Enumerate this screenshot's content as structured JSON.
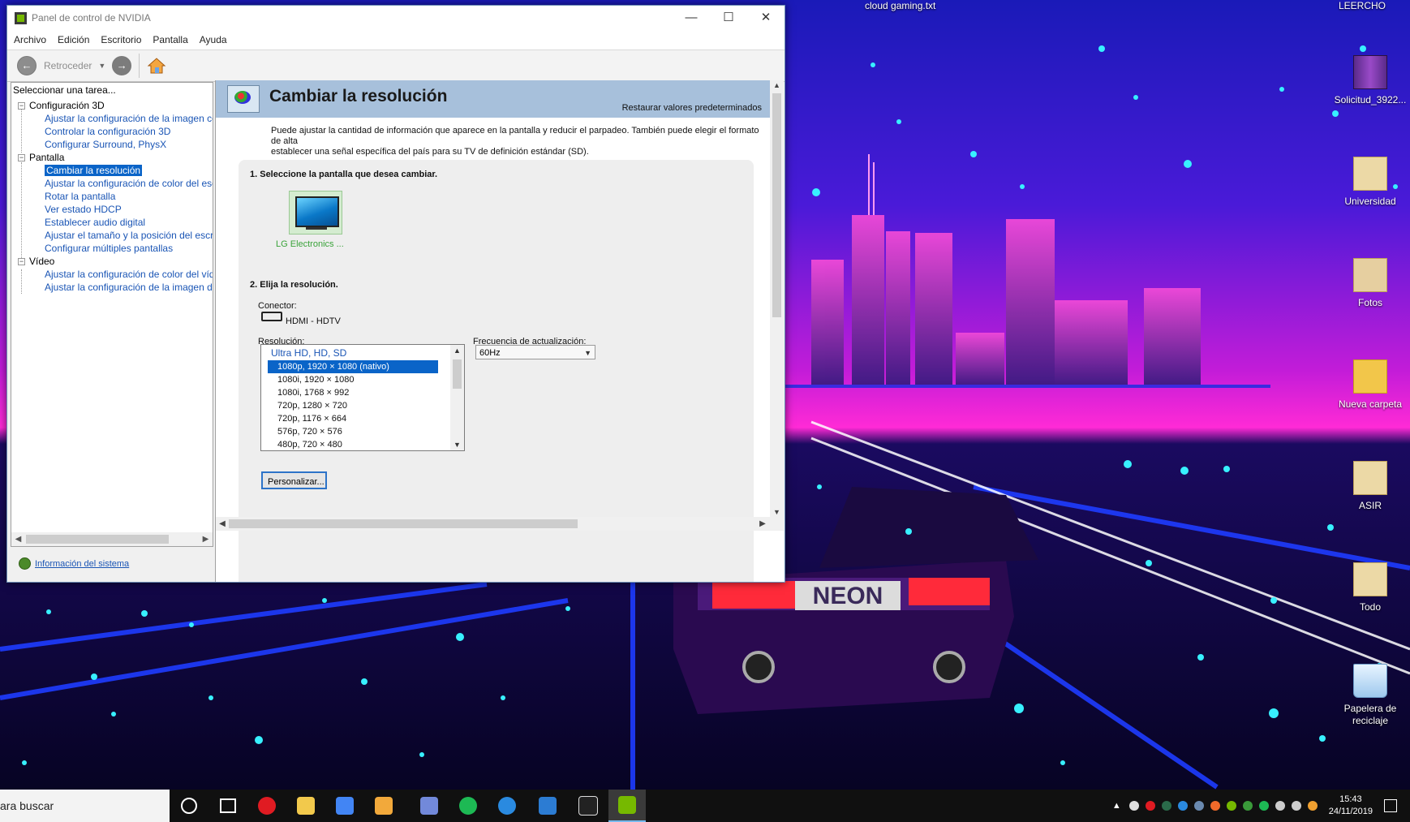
{
  "window": {
    "title": "Panel de control de NVIDIA",
    "controls": [
      "—",
      "☐",
      "✕"
    ]
  },
  "menu": [
    "Archivo",
    "Edición",
    "Escritorio",
    "Pantalla",
    "Ayuda"
  ],
  "toolbar": {
    "back_label": "Retroceder"
  },
  "tree": {
    "header": "Seleccionar una tarea...",
    "categories": [
      {
        "label": "Configuración 3D",
        "items": [
          "Ajustar la configuración de la imagen con v",
          "Controlar la configuración 3D",
          "Configurar Surround, PhysX"
        ]
      },
      {
        "label": "Pantalla",
        "items": [
          "Cambiar la resolución",
          "Ajustar la configuración de color del escrito",
          "Rotar la pantalla",
          "Ver estado HDCP",
          "Establecer audio digital",
          "Ajustar el tamaño y la posición del escritori",
          "Configurar múltiples pantallas"
        ]
      },
      {
        "label": "Vídeo",
        "items": [
          "Ajustar la configuración de color del vídeo",
          "Ajustar la configuración de la imagen de víc"
        ]
      }
    ],
    "selected_item": "Cambiar la resolución"
  },
  "sysinfo_link": "Información del sistema",
  "content": {
    "title": "Cambiar la resolución",
    "restore_link": "Restaurar valores predeterminados",
    "description_line1": "Puede ajustar la cantidad de información que aparece en la pantalla y reducir el parpadeo. También puede elegir el formato de alta",
    "description_line2": "establecer una señal específica del país para su TV de definición estándar (SD).",
    "step1": "1. Seleccione la pantalla que desea cambiar.",
    "display_name": "LG Electronics ...",
    "step2": "2. Elija la resolución.",
    "connector_label": "Conector:",
    "connector_value": "HDMI - HDTV",
    "resolution_label": "Resolución:",
    "resolution_group": "Ultra HD, HD, SD",
    "resolutions": [
      "1080p, 1920 × 1080 (nativo)",
      "1080i, 1920 × 1080",
      "1080i, 1768 × 992",
      "720p, 1280 × 720",
      "720p, 1176 × 664",
      "576p, 720 × 576",
      "480p, 720 × 480"
    ],
    "selected_resolution": "1080p, 1920 × 1080 (nativo)",
    "refresh_label": "Frecuencia de actualización:",
    "refresh_value": "60Hz",
    "customize_button": "Personalizar..."
  },
  "desktop": {
    "top_labels": [
      "cloud gaming.txt",
      "LEERCHO"
    ],
    "icons": [
      {
        "label": "Solicitud_3922...",
        "icon": "winrar-archive-icon",
        "color": "#7a3fa0"
      },
      {
        "label": "Universidad",
        "icon": "folder-icon",
        "color": "#e6c15a"
      },
      {
        "label": "Fotos",
        "icon": "folder-icon",
        "color": "#e6c15a"
      },
      {
        "label": "Nueva carpeta",
        "icon": "folder-icon",
        "color": "#f0c040"
      },
      {
        "label": "ASIR",
        "icon": "folder-icon",
        "color": "#e6c15a"
      },
      {
        "label": "Todo",
        "icon": "folder-icon",
        "color": "#e6c15a"
      },
      {
        "label": "Papelera de reciclaje",
        "icon": "recycle-bin-icon",
        "color": "#9ec9ee"
      }
    ],
    "wallpaper_text": "NEON"
  },
  "taskbar": {
    "search_text": "ara buscar",
    "apps": [
      {
        "name": "cortana-icon",
        "color": "#ffffff"
      },
      {
        "name": "task-view-icon",
        "color": "#ffffff"
      },
      {
        "name": "opera-icon",
        "color": "#e01b22"
      },
      {
        "name": "file-explorer-icon",
        "color": "#f2c94c"
      },
      {
        "name": "chrome-icon",
        "color": "#4285f4"
      },
      {
        "name": "vectorial-icon",
        "color": "#f2a93b"
      },
      {
        "name": "discord-icon",
        "color": "#7289da"
      },
      {
        "name": "spotify-icon",
        "color": "#1db954"
      },
      {
        "name": "uplay-icon",
        "color": "#2a8ae0"
      },
      {
        "name": "vscode-icon",
        "color": "#2c7cd3"
      },
      {
        "name": "mw-game-icon",
        "color": "#dddddd"
      },
      {
        "name": "nvidia-icon",
        "color": "#76b900"
      }
    ],
    "clock_time": "15:43",
    "clock_date": "24/11/2019"
  }
}
